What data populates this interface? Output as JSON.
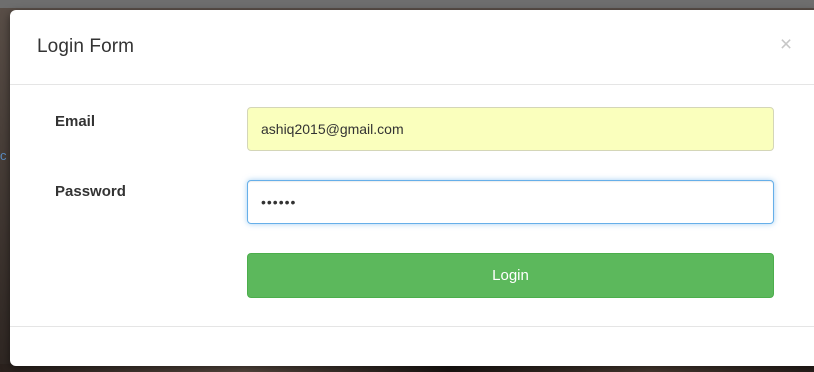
{
  "modal": {
    "title": "Login Form",
    "close_glyph": "×",
    "close_icon": "close-icon"
  },
  "form": {
    "email": {
      "label": "Email",
      "value": "ashiq2015@gmail.com",
      "autofill_background": "#faffbd"
    },
    "password": {
      "label": "Password",
      "masked_value": "••••••",
      "focused": true
    },
    "submit_label": "Login"
  },
  "colors": {
    "primary_button": "#5cb85c",
    "focus_border": "#66afe9"
  }
}
